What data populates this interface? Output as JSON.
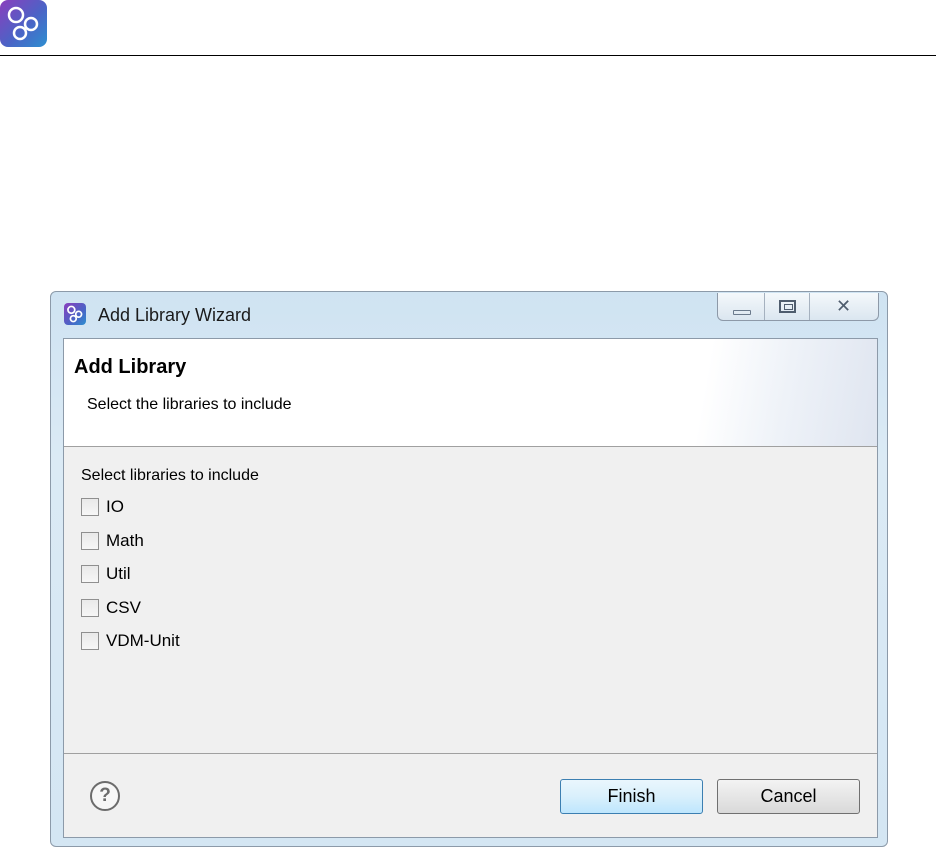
{
  "app": {
    "logo_icon": "overture-logo-icon",
    "brand_colors": [
      "#8a3fbd",
      "#2d8fd0"
    ]
  },
  "window": {
    "title": "Add Library Wizard",
    "controls": {
      "minimize": "minimize-icon",
      "maximize": "maximize-icon",
      "close": "close-icon"
    }
  },
  "banner": {
    "title": "Add Library",
    "description": "Select the libraries to include"
  },
  "libraries": {
    "label": "Select libraries to include",
    "items": [
      {
        "label": "IO",
        "checked": false
      },
      {
        "label": "Math",
        "checked": false
      },
      {
        "label": "Util",
        "checked": false
      },
      {
        "label": "CSV",
        "checked": false
      },
      {
        "label": "VDM-Unit",
        "checked": false
      }
    ]
  },
  "footer": {
    "help": "?",
    "finish_label": "Finish",
    "cancel_label": "Cancel"
  }
}
